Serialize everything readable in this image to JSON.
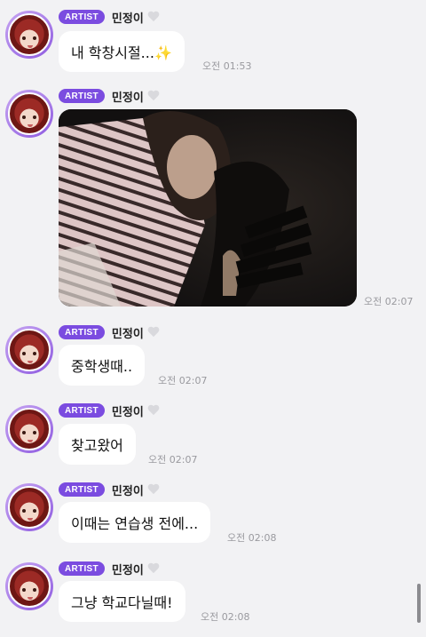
{
  "sender": {
    "badge": "ARTIST",
    "name": "민정이"
  },
  "messages": [
    {
      "type": "text",
      "text": "내 학창시절...✨",
      "time": "오전 01:53"
    },
    {
      "type": "image",
      "time": "오전 02:07"
    },
    {
      "type": "text",
      "text": "중학생때..",
      "time": "오전 02:07"
    },
    {
      "type": "text",
      "text": "찾고왔어",
      "time": "오전 02:07"
    },
    {
      "type": "text",
      "text": "이때는 연습생 전에...",
      "time": "오전 02:08"
    },
    {
      "type": "text",
      "text": "그냥 학교다닐때!",
      "time": "오전 02:08"
    }
  ],
  "colors": {
    "background": "#f2f2f4",
    "badge": "#7b4ce0",
    "bubble": "#ffffff",
    "time": "#9a9a9f"
  }
}
